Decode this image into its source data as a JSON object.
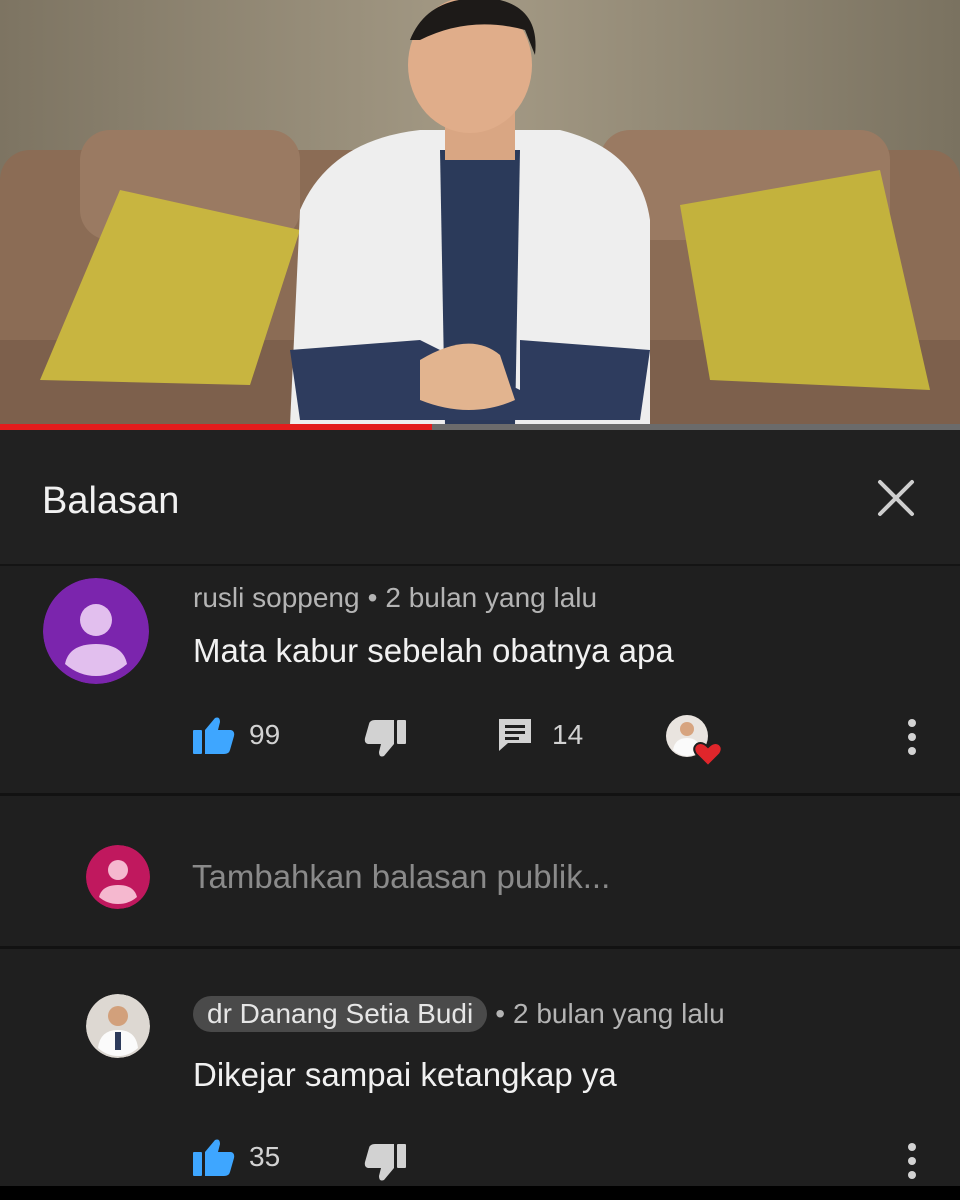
{
  "video": {
    "progress": 0.45
  },
  "panel": {
    "title": "Balasan",
    "close_icon": "close-icon"
  },
  "comment": {
    "author": "rusli soppeng",
    "separator": "•",
    "time": "2 bulan yang lalu",
    "text": "Mata kabur sebelah obatnya apa",
    "likes": "99",
    "replies": "14",
    "avatar_color": "#7b25ad",
    "like_color": "#3ea6ff"
  },
  "reply_box": {
    "placeholder": "Tambahkan balasan publik...",
    "avatar_color": "#c0185e"
  },
  "reply": {
    "author": "dr Danang Setia Budi",
    "separator": "•",
    "time": "2 bulan yang lalu",
    "text": "Dikejar sampai ketangkap ya",
    "likes": "35"
  }
}
